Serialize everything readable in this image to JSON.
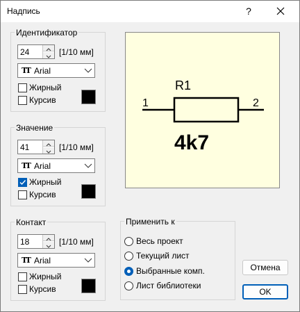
{
  "window": {
    "title": "Надпись"
  },
  "titlebar": {
    "help_label": "?",
    "close_icon": "close-icon"
  },
  "identifier": {
    "group_label": "Идентификатор",
    "size_value": "24",
    "unit": "[1/10 мм]",
    "font": "Arial",
    "bold": {
      "label": "Жирный",
      "checked": false
    },
    "italic": {
      "label": "Курсив",
      "checked": false
    },
    "color": "#000000"
  },
  "value_group": {
    "group_label": "Значение",
    "size_value": "41",
    "unit": "[1/10 мм]",
    "font": "Arial",
    "bold": {
      "label": "Жирный",
      "checked": true
    },
    "italic": {
      "label": "Курсив",
      "checked": false
    },
    "color": "#000000"
  },
  "contact": {
    "group_label": "Контакт",
    "size_value": "18",
    "unit": "[1/10 мм]",
    "font": "Arial",
    "bold": {
      "label": "Жирный",
      "checked": false
    },
    "italic": {
      "label": "Курсив",
      "checked": false
    },
    "color": "#000000"
  },
  "preview": {
    "ref": "R1",
    "pin1": "1",
    "pin2": "2",
    "value": "4k7",
    "background": "#ffffe0"
  },
  "apply_to": {
    "group_label": "Применить к",
    "options": [
      {
        "label": "Весь проект",
        "selected": false
      },
      {
        "label": "Текущий лист",
        "selected": false
      },
      {
        "label": "Выбранные комп.",
        "selected": true
      },
      {
        "label": "Лист библиотеки",
        "selected": false
      }
    ]
  },
  "buttons": {
    "cancel": "Отмена",
    "ok": "OK"
  },
  "colors": {
    "accent": "#005fb8",
    "dialog_bg": "#f0f0f0"
  }
}
